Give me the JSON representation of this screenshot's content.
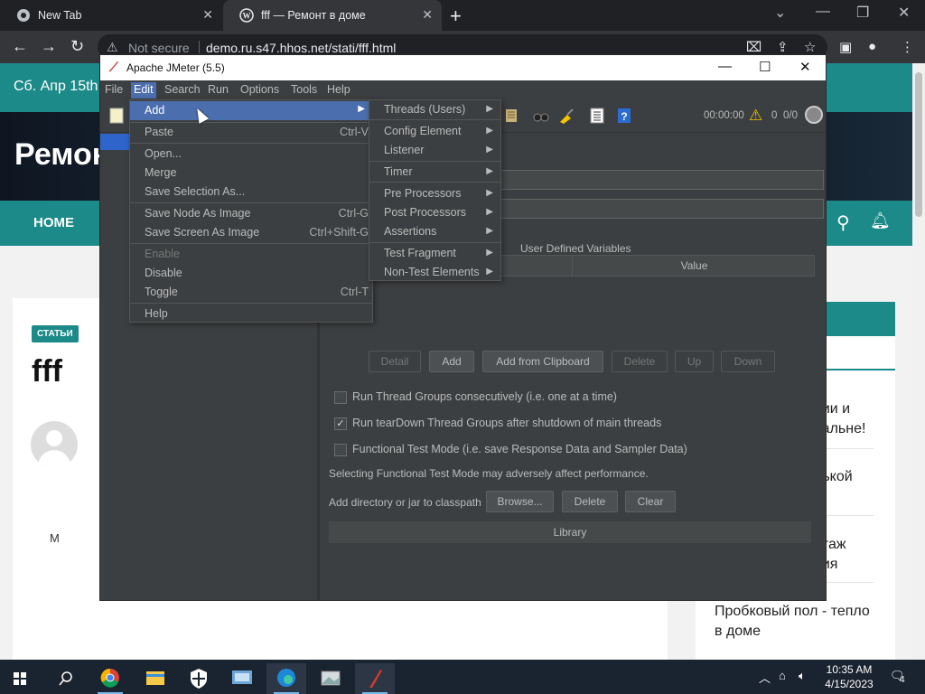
{
  "browser": {
    "tabs": [
      {
        "title": "New Tab"
      },
      {
        "title": "fff — Ремонт в доме"
      }
    ],
    "omnibox": {
      "security": "Not secure",
      "url": "demo.ru.s47.hhos.net/stati/fff.html"
    }
  },
  "site": {
    "date": "Сб. Апр 15th",
    "brand": "Ремон",
    "nav_home": "HOME",
    "badge": "СТАТЬИ",
    "post_title": "fff",
    "author_initial": "М",
    "sidebar": [
      {
        "text": "нии и\nпальне!"
      },
      {
        "text": "лькой"
      },
      {
        "text": "нтаж\nния"
      },
      {
        "text": "Пробковый пол - тепло\nв доме"
      }
    ],
    "colors": {
      "accent": "#1b8a88"
    }
  },
  "jmeter": {
    "title": "Apache JMeter (5.5)",
    "menus": [
      "File",
      "Edit",
      "Search",
      "Run",
      "Options",
      "Tools",
      "Help"
    ],
    "active_menu": "Edit",
    "timer": "00:00:00",
    "warning_count": "0",
    "threads": "0/0",
    "user_defined_variables": "User Defined Variables",
    "table_headers": [
      "",
      "Value"
    ],
    "buttons": {
      "detail": "Detail",
      "add": "Add",
      "add_from_clipboard": "Add from Clipboard",
      "delete": "Delete",
      "up": "Up",
      "down": "Down",
      "browse": "Browse...",
      "delete2": "Delete",
      "clear": "Clear"
    },
    "checkboxes": [
      {
        "label": "Run Thread Groups consecutively (i.e. one at a time)",
        "checked": false
      },
      {
        "label": "Run tearDown Thread Groups after shutdown of main threads",
        "checked": true
      },
      {
        "label": "Functional Test Mode (i.e. save Response Data and Sampler Data)",
        "checked": false
      }
    ],
    "functional_note": "Selecting Functional Test Mode may adversely affect performance.",
    "classpath_label": "Add directory or jar to classpath",
    "library_header": "Library",
    "edit_menu": [
      {
        "label": "Add",
        "shortcut": "",
        "submenu": true,
        "highlighted": true
      },
      {
        "label": "Paste",
        "shortcut": "Ctrl-V"
      },
      {
        "label": "Open...",
        "shortcut": ""
      },
      {
        "label": "Merge",
        "shortcut": ""
      },
      {
        "label": "Save Selection As...",
        "shortcut": ""
      },
      {
        "label": "Save Node As Image",
        "shortcut": "Ctrl-G"
      },
      {
        "label": "Save Screen As Image",
        "shortcut": "Ctrl+Shift-G"
      },
      {
        "label": "Enable",
        "shortcut": "",
        "disabled": true
      },
      {
        "label": "Disable",
        "shortcut": ""
      },
      {
        "label": "Toggle",
        "shortcut": "Ctrl-T"
      },
      {
        "label": "Help",
        "shortcut": ""
      }
    ],
    "add_submenu": [
      "Threads (Users)",
      "Config Element",
      "Listener",
      "Timer",
      "Pre Processors",
      "Post Processors",
      "Assertions",
      "Test Fragment",
      "Non-Test Elements"
    ]
  },
  "taskbar": {
    "time": "10:35 AM",
    "date": "4/15/2023",
    "notifications": "4"
  }
}
